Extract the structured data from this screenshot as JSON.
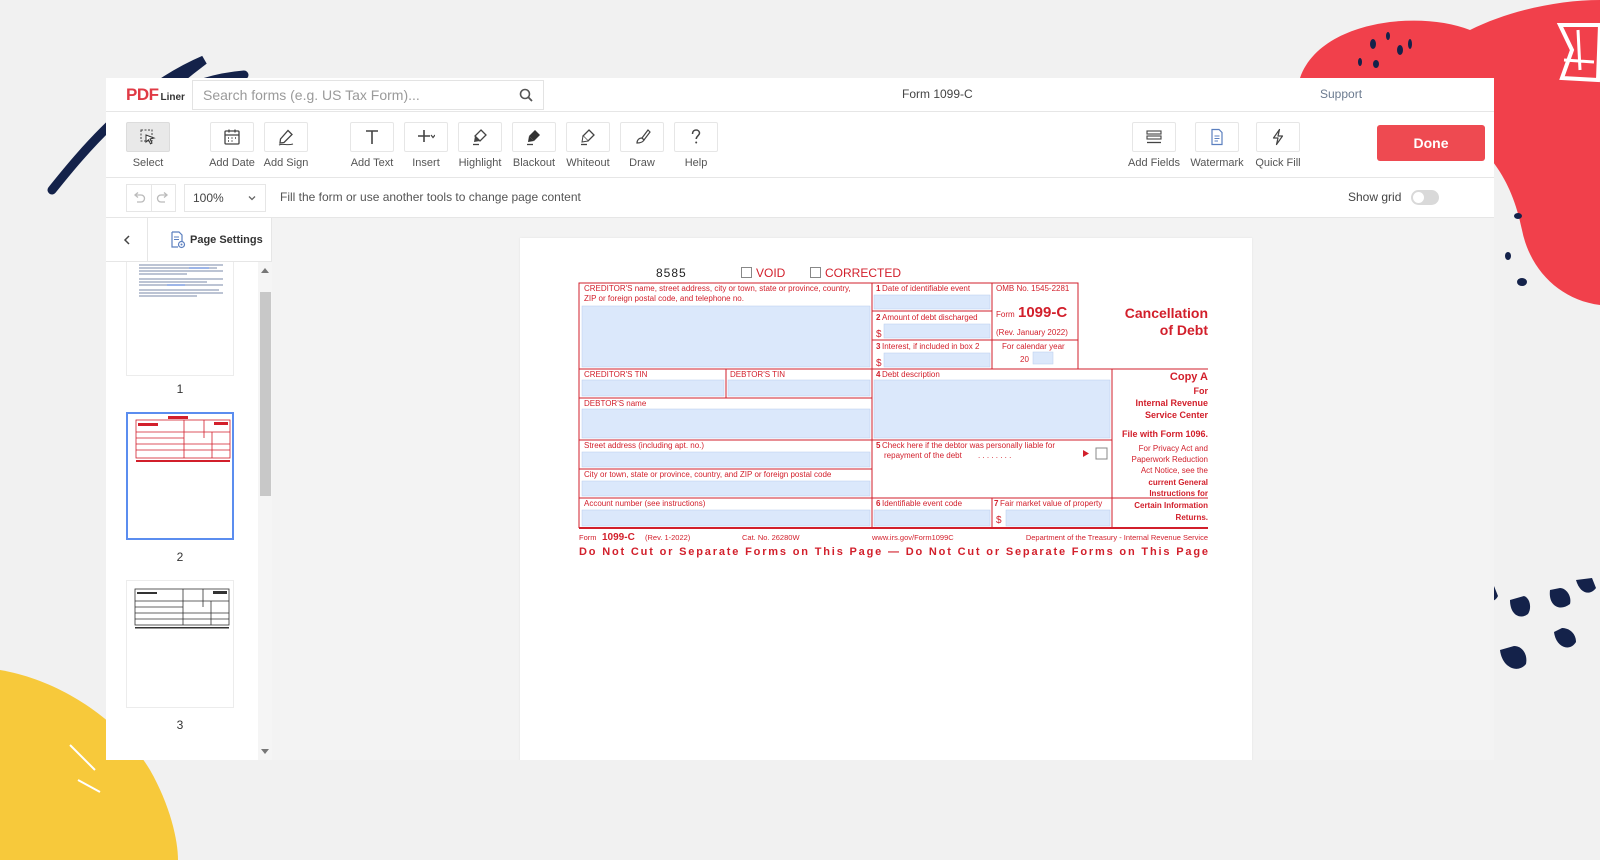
{
  "app": {
    "logo_main": "PDF",
    "logo_sub": "Liner",
    "search_placeholder": "Search forms (e.g. US Tax Form)...",
    "doc_title": "Form 1099-C",
    "support": "Support"
  },
  "toolbar": {
    "select": "Select",
    "add_date": "Add Date",
    "add_sign": "Add Sign",
    "add_text": "Add Text",
    "insert": "Insert",
    "highlight": "Highlight",
    "blackout": "Blackout",
    "whiteout": "Whiteout",
    "draw": "Draw",
    "help": "Help",
    "add_fields": "Add Fields",
    "watermark": "Watermark",
    "quick_fill": "Quick Fill",
    "done": "Done"
  },
  "subbar": {
    "zoom": "100%",
    "hint": "Fill the form or use another tools to change page content",
    "show_grid": "Show grid",
    "show_grid_on": false
  },
  "sidebar": {
    "page_settings": "Page Settings",
    "pages": [
      "1",
      "2",
      "3"
    ],
    "selected_page": "2"
  },
  "form": {
    "code": "8585",
    "void": "VOID",
    "corrected": "CORRECTED",
    "creditor_name_label": "CREDITOR'S name, street address, city or town, state or province, country,",
    "creditor_name_label2": "ZIP or foreign postal code, and telephone no.",
    "box1": "Date of identifiable event",
    "box2": "Amount of debt discharged",
    "box3": "Interest, if included in box 2",
    "omb": "OMB No. 1545-2281",
    "form_word": "Form",
    "form_number": "1099-C",
    "rev": "(Rev. January 2022)",
    "calendar_year": "For calendar year",
    "year_prefix": "20",
    "title1": "Cancellation",
    "title2": "of Debt",
    "creditor_tin": "CREDITOR'S TIN",
    "debtor_tin": "DEBTOR'S TIN",
    "box4": "Debt description",
    "debtor_name": "DEBTOR'S name",
    "street": "Street address (including apt. no.)",
    "city": "City or town, state or province, country, and ZIP or foreign postal code",
    "box5a": "Check here if the debtor was personally liable for",
    "box5b": "repayment of the debt",
    "account": "Account number (see instructions)",
    "box6": "Identifiable event code",
    "box7": "Fair market value of property",
    "copy_a": "Copy A",
    "for": "For",
    "irs1": "Internal Revenue",
    "irs2": "Service Center",
    "file_with": "File with Form 1096.",
    "privacy1": "For Privacy Act and",
    "privacy2": "Paperwork Reduction",
    "privacy3": "Act Notice, see the",
    "privacy4": "current General",
    "privacy5": "Instructions for",
    "privacy6": "Certain Information",
    "privacy7": "Returns.",
    "footer_form": "Form",
    "footer_number": "1099-C",
    "footer_rev": "(Rev. 1-2022)",
    "footer_cat": "Cat. No. 26280W",
    "footer_url": "www.irs.gov/Form1099C",
    "footer_dept": "Department of the Treasury - Internal Revenue Service",
    "do_not_cut": "Do Not Cut or Separate Forms on This Page — Do Not Cut or Separate Forms on This Page"
  },
  "colors": {
    "form_red": "#d21f2b",
    "field_fill": "#dbe8fb",
    "done_button": "#ee4a51",
    "selected_thumb": "#5b8def",
    "deco_red": "#f1404b",
    "deco_yellow": "#f7c93b",
    "deco_navy": "#14224a"
  },
  "icons": {
    "search": "search-icon",
    "select": "cursor-icon",
    "add_date": "calendar-icon",
    "add_sign": "pen-icon",
    "add_text": "text-icon",
    "insert": "plus-icon",
    "highlight": "highlighter-icon",
    "blackout": "eraser-icon",
    "whiteout": "eraser-icon",
    "draw": "brush-icon",
    "help": "question-icon",
    "add_fields": "fields-icon",
    "watermark": "watermark-icon",
    "quick_fill": "lightning-icon",
    "undo": "undo-icon",
    "redo": "redo-icon",
    "collapse": "chevron-left-icon",
    "page_settings": "page-settings-icon"
  }
}
